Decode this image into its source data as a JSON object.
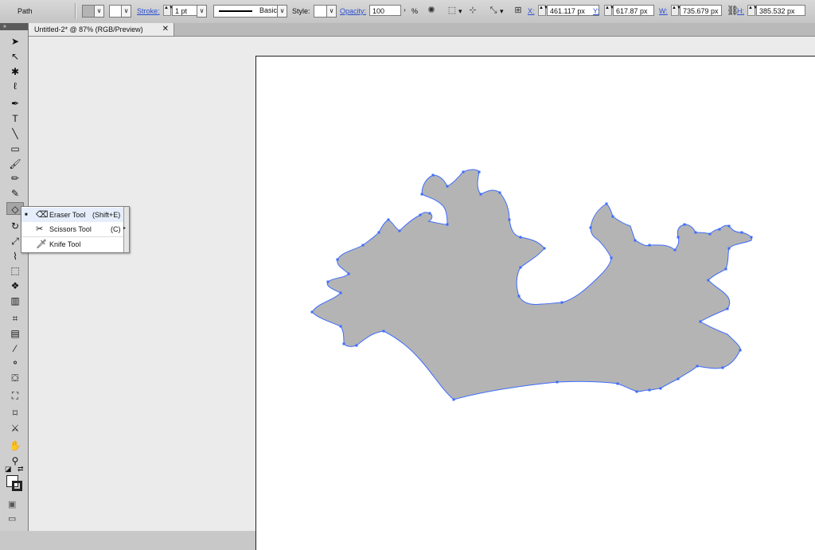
{
  "control_bar": {
    "selection_label": "Path",
    "fill_color": "#b4b4b4",
    "stroke_label": "Stroke:",
    "stroke_weight": "1 pt",
    "brush_definition": "Basic",
    "style_label": "Style:",
    "opacity_label": "Opacity:",
    "opacity_value": "100",
    "opacity_unit": "%",
    "x_label": "X:",
    "x_value": "461.117 px",
    "y_label": "Y:",
    "y_value": "617.87 px",
    "w_label": "W:",
    "w_value": "735.679 px",
    "h_label": "H:",
    "h_value": "385.532 px",
    "dropdown_glyph": "∨",
    "spin_glyph": "▲▼",
    "more_glyph": "▾"
  },
  "toolbox": {
    "collapse_glyph": "»",
    "tools": [
      {
        "name": "selection-tool-icon",
        "glyph": "➤"
      },
      {
        "name": "direct-selection-tool-icon",
        "glyph": "↖"
      },
      {
        "name": "magic-wand-tool-icon",
        "glyph": "✱"
      },
      {
        "name": "lasso-tool-icon",
        "glyph": "ℓ"
      },
      {
        "name": "pen-tool-icon",
        "glyph": "✒"
      },
      {
        "name": "type-tool-icon",
        "glyph": "T"
      },
      {
        "name": "line-segment-tool-icon",
        "glyph": "╲"
      },
      {
        "name": "rectangle-tool-icon",
        "glyph": "▭"
      },
      {
        "name": "paintbrush-tool-icon",
        "glyph": "🖌"
      },
      {
        "name": "pencil-tool-icon",
        "glyph": "✏"
      },
      {
        "name": "blob-brush-tool-icon",
        "glyph": "✎"
      },
      {
        "name": "eraser-tool-icon",
        "glyph": "◇"
      },
      {
        "name": "rotate-tool-icon",
        "glyph": "↻"
      },
      {
        "name": "scale-tool-icon",
        "glyph": "⤢"
      },
      {
        "name": "warp-tool-icon",
        "glyph": "⌇"
      },
      {
        "name": "free-transform-tool-icon",
        "glyph": "⬚"
      },
      {
        "name": "symbol-sprayer-tool-icon",
        "glyph": "❖"
      },
      {
        "name": "column-graph-tool-icon",
        "glyph": "▥"
      },
      {
        "name": "mesh-tool-icon",
        "glyph": "⌗"
      },
      {
        "name": "gradient-tool-icon",
        "glyph": "▤"
      },
      {
        "name": "eyedropper-tool-icon",
        "glyph": "⁄"
      },
      {
        "name": "blend-tool-icon",
        "glyph": "⚬"
      },
      {
        "name": "live-paint-bucket-tool-icon",
        "glyph": "⛋"
      },
      {
        "name": "live-paint-selection-tool-icon",
        "glyph": "⛶"
      },
      {
        "name": "artboard-tool-icon",
        "glyph": "⌑"
      },
      {
        "name": "slice-tool-icon",
        "glyph": "⚔"
      },
      {
        "name": "hand-tool-icon",
        "glyph": "✋"
      },
      {
        "name": "zoom-tool-icon",
        "glyph": "⚲"
      }
    ],
    "default_colors_glyph": "◪",
    "swap_colors_glyph": "⇄",
    "color_mode_glyph": "▣",
    "screen_mode_glyph": "▭"
  },
  "document": {
    "tab_title": "Untitled-2* @ 87% (RGB/Preview)",
    "close_glyph": "✕",
    "shape_fill": "#b4b4b4",
    "shape_stroke": "#3d6bff"
  },
  "flyout": {
    "items": [
      {
        "label": "Eraser Tool",
        "shortcut": "(Shift+E)",
        "icon": "⌫",
        "selected": true
      },
      {
        "label": "Scissors Tool",
        "shortcut": "(C)",
        "icon": "✂",
        "selected": false
      },
      {
        "label": "Knife Tool",
        "shortcut": "",
        "icon": "🗡",
        "selected": false
      }
    ],
    "bullet": "■",
    "tearoff_glyph": "▸"
  }
}
